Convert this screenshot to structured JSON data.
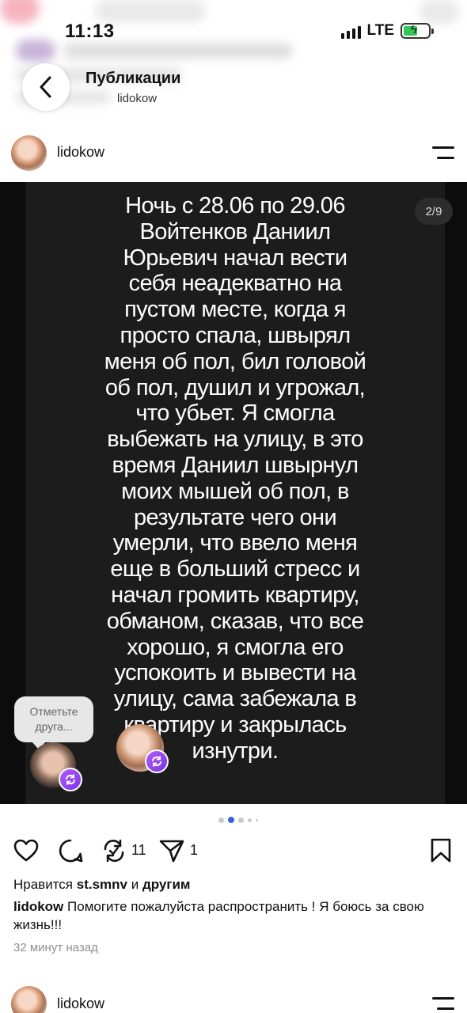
{
  "status_bar": {
    "time": "11:13",
    "network": "LTE"
  },
  "header": {
    "title": "Публикации",
    "subtitle": "lidokow"
  },
  "post": {
    "username": "lidokow",
    "page_counter": "2/9",
    "story_lines": [
      "Ночь с 28.06 по 29.06",
      "Войтенков Даниил",
      "Юрьевич начал вести",
      "себя неадекватно на",
      "пустом месте, когда я",
      "просто спала, швырял",
      "меня об пол, бил головой",
      "об пол, душил и угрожал,",
      "что убьет. Я смогла",
      "выбежать на улицу, в это",
      "время Даниил швырнул",
      "моих мышей об пол, в",
      "результате чего они",
      "умерли, что ввело меня",
      "еще в больший стресс и",
      "начал громить квартиру,",
      "обманом, сказав, что все",
      "хорошо, я смогла его",
      "успокоить и вывести на",
      "улицу, сама забежала в",
      "квартиру и закрылась",
      "изнутри."
    ],
    "tag_prompt_line1": "Отметьте",
    "tag_prompt_line2": "друга...",
    "carousel": {
      "total_dots": 5,
      "active_index": 1
    },
    "repost_count": "11",
    "share_count": "1",
    "likes": {
      "prefix": "Нравится",
      "user": "st.smnv",
      "and": "и",
      "others": "другим"
    },
    "caption": {
      "user": "lidokow",
      "text": "Помогите пожалуйста распространить ! Я боюсь за свою жизнь!!!"
    },
    "time_ago": "32 минут назад"
  },
  "next_post": {
    "username": "lidokow"
  },
  "icons": {
    "back": "chevron-left-icon",
    "menu": "menu-icon",
    "like": "heart-icon",
    "comment": "comment-icon",
    "repost": "repost-icon",
    "share": "send-icon",
    "save": "bookmark-icon"
  },
  "colors": {
    "accent_dot": "#3a5fe0",
    "repost_badge": "#8a3ff0",
    "battery": "#33c659"
  }
}
